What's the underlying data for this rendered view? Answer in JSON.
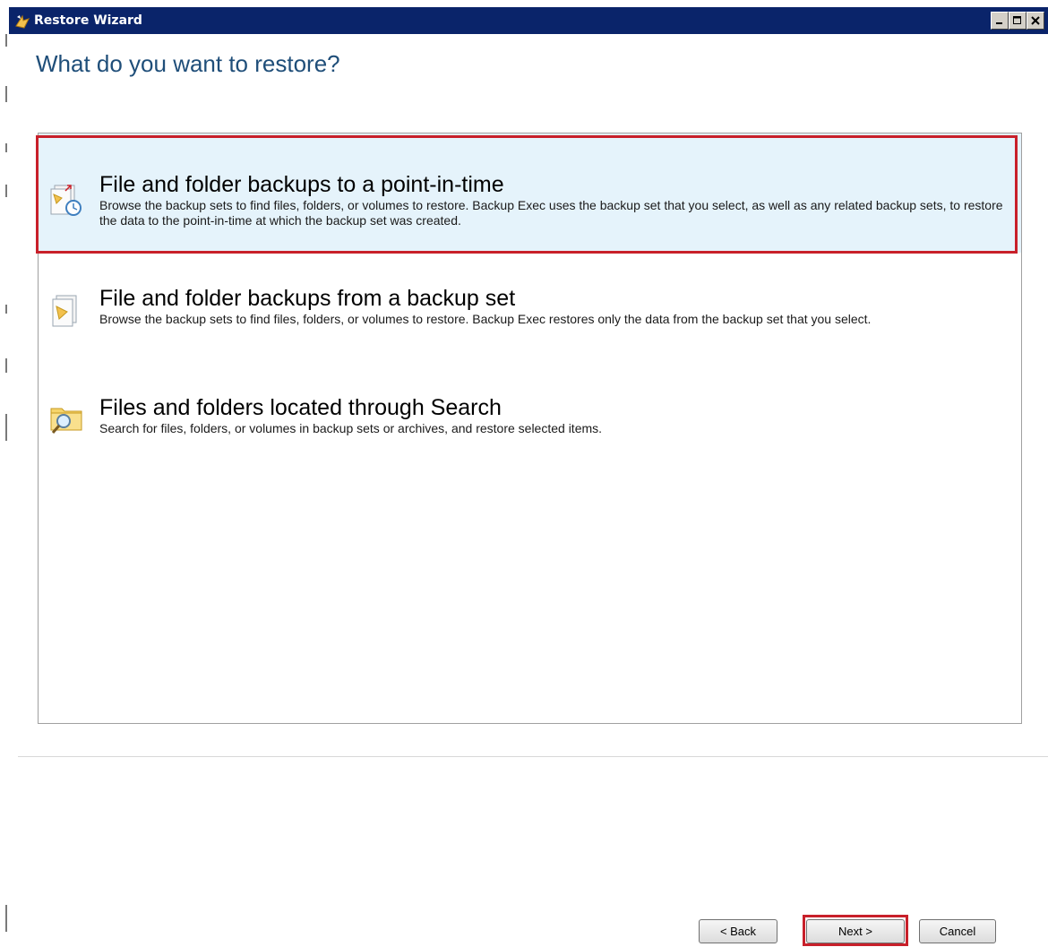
{
  "window": {
    "title": "Restore Wizard"
  },
  "page": {
    "heading": "What do you want to restore?"
  },
  "options": [
    {
      "title": "File and folder backups to a point-in-time",
      "description": "Browse the backup sets to find files, folders, or volumes to restore. Backup Exec uses the backup set that you select, as well as any related backup sets, to restore the data to the point-in-time at which the backup set was created.",
      "icon": "point-in-time-restore-icon",
      "selected": true
    },
    {
      "title": "File and folder backups from a backup set",
      "description": "Browse the backup sets to find files, folders, or volumes to restore. Backup Exec restores only the data from the backup set that you select.",
      "icon": "backup-set-restore-icon",
      "selected": false
    },
    {
      "title": "Files and folders located through Search",
      "description": "Search for files, folders, or volumes in backup sets or archives, and restore selected items.",
      "icon": "search-folder-icon",
      "selected": false
    }
  ],
  "buttons": {
    "back": "< Back",
    "next": "Next >",
    "cancel": "Cancel"
  },
  "colors": {
    "titlebar": "#0a246a",
    "heading": "#1f4e79",
    "selection_bg": "#e5f3fb",
    "highlight": "#c8202a"
  }
}
